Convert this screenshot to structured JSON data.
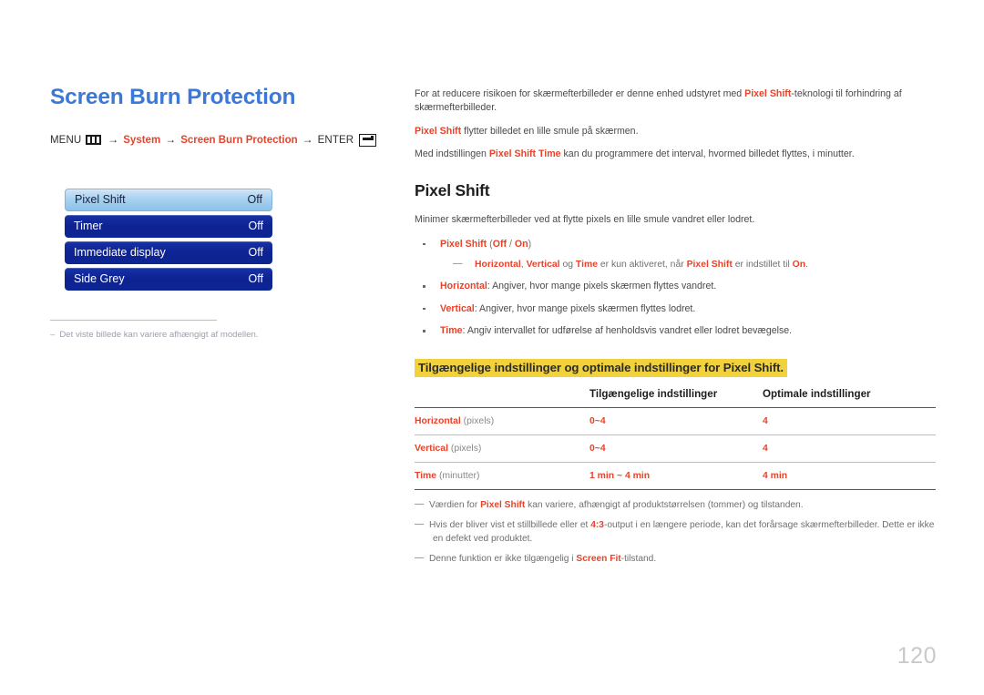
{
  "page": {
    "title": "Screen Burn Protection",
    "number": "120"
  },
  "menu_path": {
    "menu_label": "MENU",
    "menu_icon": "menu-bars-icon",
    "arrow": "→",
    "step1": "System",
    "step2": "Screen Burn Protection",
    "enter_label": "ENTER",
    "enter_icon": "enter-return-icon"
  },
  "osd_menu": {
    "items": [
      {
        "label": "Pixel Shift",
        "value": "Off",
        "selected": true
      },
      {
        "label": "Timer",
        "value": "Off",
        "selected": false
      },
      {
        "label": "Immediate display",
        "value": "Off",
        "selected": false
      },
      {
        "label": "Side Grey",
        "value": "Off",
        "selected": false
      }
    ]
  },
  "left_note": {
    "dash": "–",
    "text": "Det viste billede kan variere afhængigt af modellen."
  },
  "intro": {
    "p1_a": "For at reducere risikoen for skærmefterbilleder er denne enhed udstyret med ",
    "p1_b": "Pixel Shift",
    "p1_c": "-teknologi til forhindring af skærmefterbilleder.",
    "p2_a": "Pixel Shift",
    "p2_b": " flytter billedet en lille smule på skærmen.",
    "p3_a": "Med indstillingen ",
    "p3_b": "Pixel Shift Time",
    "p3_c": " kan du programmere det interval, hvormed billedet flyttes, i minutter."
  },
  "section": {
    "title": "Pixel Shift",
    "lead": "Minimer skærmefterbilleder ved at flytte pixels en lille smule vandret eller lodret.",
    "bullets": [
      {
        "label": "Pixel Shift",
        "paren_open": " (",
        "opt1": "Off",
        "sep": " / ",
        "opt2": "On",
        "paren_close": ")"
      },
      {
        "label": "Horizontal",
        "text": ": Angiver, hvor mange pixels skærmen flyttes vandret."
      },
      {
        "label": "Vertical",
        "text": ": Angiver, hvor mange pixels skærmen flyttes lodret."
      },
      {
        "label": "Time",
        "text": ": Angiv intervallet for udførelse af henholdsvis vandret eller lodret bevægelse."
      }
    ],
    "subnote": {
      "dash": "—",
      "a": "Horizontal",
      "b": ", ",
      "c": "Vertical",
      "d": " og ",
      "e": "Time",
      "f": " er kun aktiveret, når ",
      "g": "Pixel Shift",
      "h": " er indstillet til ",
      "i": "On",
      "j": "."
    }
  },
  "table": {
    "heading": "Tilgængelige indstillinger og optimale indstillinger for Pixel Shift.",
    "columns": [
      "",
      "Tilgængelige indstillinger",
      "Optimale indstillinger"
    ],
    "rows": [
      {
        "label": "Horizontal",
        "unit": " (pixels)",
        "available": "0~4",
        "optimal": "4"
      },
      {
        "label": "Vertical",
        "unit": " (pixels)",
        "available": "0~4",
        "optimal": "4"
      },
      {
        "label": "Time",
        "unit": " (minutter)",
        "available": "1 min ~ 4 min",
        "optimal": "4 min"
      }
    ]
  },
  "footnotes": [
    {
      "dash": "—",
      "a": "Værdien for ",
      "b": "Pixel Shift",
      "c": " kan variere, afhængigt af produktstørrelsen (tommer) og tilstanden."
    },
    {
      "dash": "—",
      "a": "Hvis der bliver vist et stillbillede eller et ",
      "b": "4:3",
      "c": "-output i en længere periode, kan det forårsage skærmefterbilleder. Dette er ikke",
      "d": "en defekt ved produktet."
    },
    {
      "dash": "—",
      "a": "Denne funktion er ikke tilgængelig i ",
      "b": "Screen Fit",
      "c": "-tilstand."
    }
  ],
  "colors": {
    "title_blue": "#3b78d8",
    "accent_red": "#e8432a",
    "highlight_yellow": "#f1d23d",
    "osd_blue": "#0e2391",
    "osd_selected": "#a9d2f0"
  }
}
